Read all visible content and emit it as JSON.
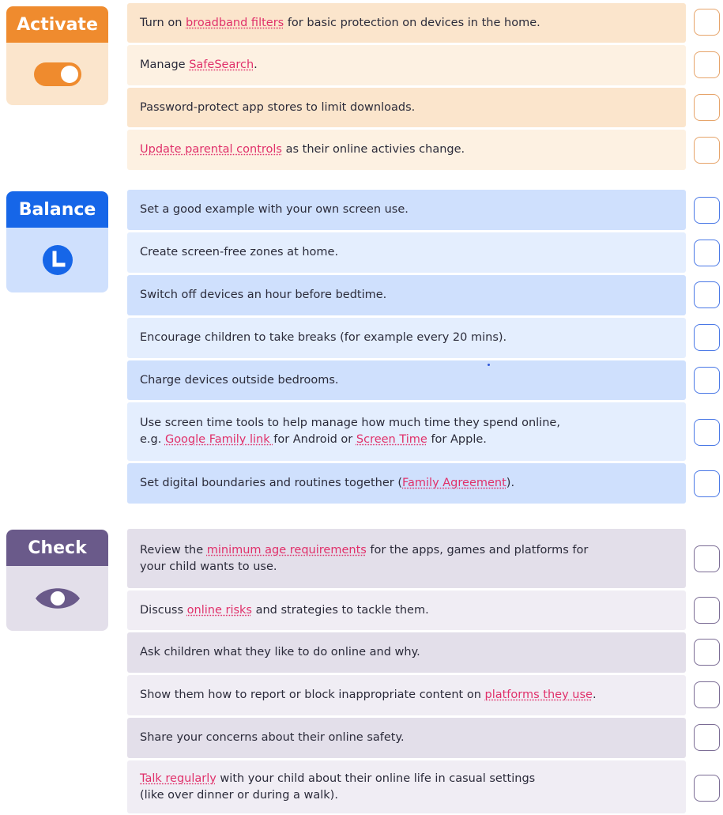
{
  "colors": {
    "activate_accent": "#ef8b2e",
    "activate_light": "#fbe5cc",
    "balance_accent": "#1666e8",
    "balance_light": "#cfe0fd",
    "check_accent": "#6a5a8a",
    "check_light": "#e3dfea",
    "link": "#e0306a"
  },
  "activate": {
    "label": "Activate",
    "icon": "toggle-switch-icon",
    "items": [
      {
        "pre": "Turn on ",
        "link": "broadband filters",
        "post": " for basic protection on devices in the home."
      },
      {
        "pre": "Manage ",
        "link": "SafeSearch",
        "post": "."
      },
      {
        "pre": "Password-protect app stores to limit downloads.",
        "link": "",
        "post": ""
      },
      {
        "pre": "",
        "link": "Update parental controls",
        "post": " as their online activies change."
      }
    ]
  },
  "balance": {
    "label": "Balance",
    "icon": "clock-icon",
    "items": [
      {
        "pre": "Set a good example with your own screen use.",
        "link": "",
        "post": ""
      },
      {
        "pre": "Create screen-free zones at home.",
        "link": "",
        "post": ""
      },
      {
        "pre": "Switch off devices an hour before bedtime.",
        "link": "",
        "post": ""
      },
      {
        "pre": "Encourage children to take breaks (for example every 20 mins).",
        "link": "",
        "post": ""
      },
      {
        "pre": "Charge devices outside bedrooms.",
        "link": "",
        "post": ""
      },
      {
        "line1": "Use screen time tools to help manage how much time they spend online,",
        "pre": "e.g. ",
        "link": "Google Family link ",
        "mid": "for Android or ",
        "link2": "Screen Time",
        "post": " for Apple."
      },
      {
        "pre": "Set digital boundaries and routines together (",
        "link": "Family Agreement",
        "post": ")."
      }
    ]
  },
  "check": {
    "label": "Check",
    "icon": "eye-icon",
    "items": [
      {
        "pre": "Review the ",
        "link": "minimum age requirements",
        "post": " for the apps, games and platforms for",
        "line2": "your child wants to use."
      },
      {
        "pre": "Discuss ",
        "link": "online risks",
        "post": " and strategies to tackle them."
      },
      {
        "pre": "Ask children what they like to do online and why.",
        "link": "",
        "post": ""
      },
      {
        "pre": "Show them how to report or block inappropriate content on ",
        "link": "platforms they use",
        "post": "."
      },
      {
        "pre": "Share your concerns about their online safety.",
        "link": "",
        "post": ""
      },
      {
        "pre": "",
        "link": "Talk regularly",
        "post": " with your child about their online life in casual settings",
        "line2": "(like over dinner or during a walk)."
      }
    ]
  }
}
